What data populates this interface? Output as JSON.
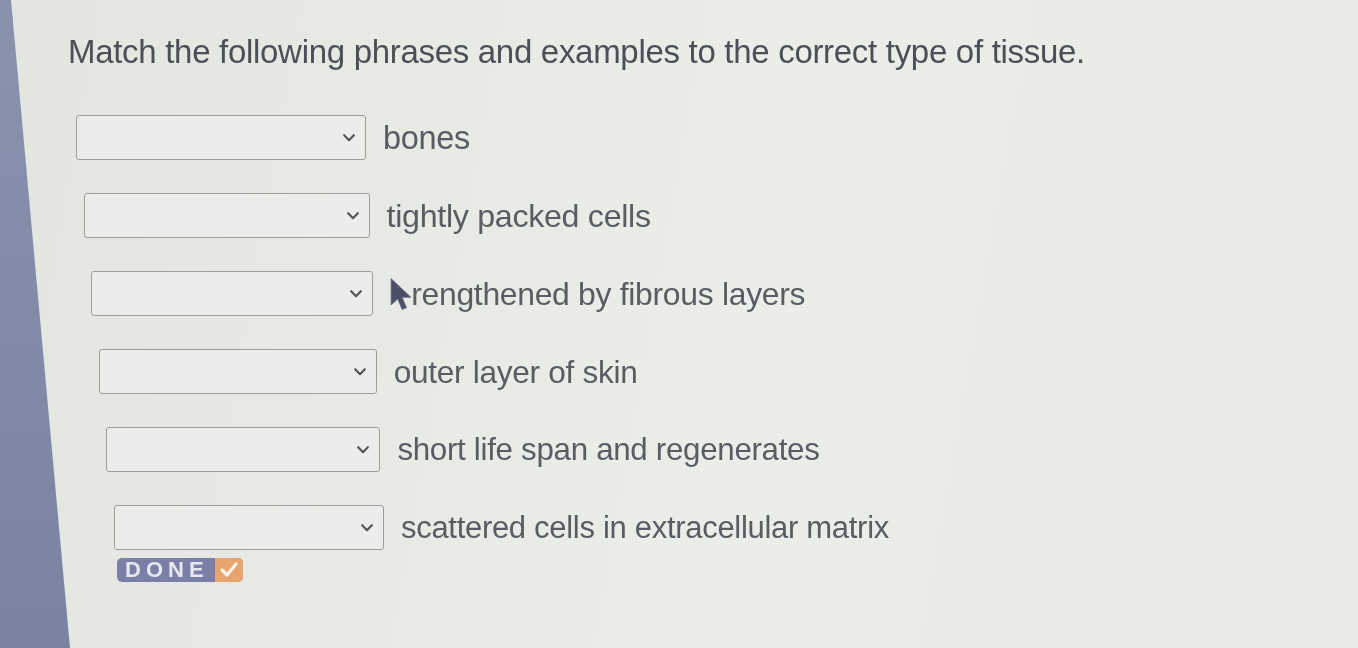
{
  "question": {
    "prompt": "Match the following phrases and examples to the correct type of tissue."
  },
  "items": [
    {
      "label": "bones",
      "pointer_over": false
    },
    {
      "label": "tightly packed cells",
      "pointer_over": false
    },
    {
      "label": "rengthened by fibrous layers",
      "pointer_over": true
    },
    {
      "label": "outer layer of skin",
      "pointer_over": false
    },
    {
      "label": "short life span and regenerates",
      "pointer_over": false
    },
    {
      "label": "scattered cells in extracellular matrix",
      "pointer_over": false
    }
  ],
  "done_button": {
    "label": "DONE"
  }
}
